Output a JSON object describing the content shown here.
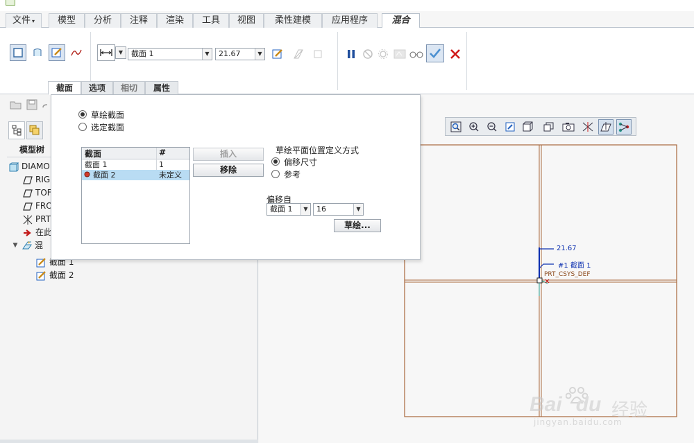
{
  "ribbon": {
    "tabs": [
      {
        "label": "文件",
        "has_menu": true
      },
      {
        "label": "模型"
      },
      {
        "label": "分析"
      },
      {
        "label": "注释"
      },
      {
        "label": "渲染"
      },
      {
        "label": "工具"
      },
      {
        "label": "视图"
      },
      {
        "label": "柔性建模"
      },
      {
        "label": "应用程序"
      },
      {
        "label": "混合",
        "active": true
      }
    ],
    "menu_caret": "▾",
    "section_combo": "截面 1",
    "depth_combo": "21.67",
    "dropdown_glyph": "▼"
  },
  "dashboard_tabs": [
    {
      "label": "截面",
      "active": true
    },
    {
      "label": "选项"
    },
    {
      "label": "相切",
      "dim": true
    },
    {
      "label": "属性"
    }
  ],
  "dialog": {
    "radio_sketch": "草绘截面",
    "radio_select": "选定截面",
    "table": {
      "col_section": "截面",
      "col_index": "#",
      "rows": [
        {
          "name": "截面 1",
          "index": "1"
        },
        {
          "name": "截面 2",
          "index": "未定义",
          "selected": true
        }
      ]
    },
    "insert_button": "插入",
    "remove_button": "移除",
    "plane_def_title": "草绘平面位置定义方式",
    "radio_offset": "偏移尺寸",
    "radio_reference": "参考",
    "offset_from_label": "偏移自",
    "offset_from_value": "截面 1",
    "offset_value": "16",
    "sketch_button": "草绘..."
  },
  "model_tree": {
    "header": "模型树",
    "items": [
      {
        "label": "DIAMO",
        "icon": "part-icon"
      },
      {
        "label": "RIG",
        "icon": "datum-plane-icon"
      },
      {
        "label": "TOF",
        "icon": "datum-plane-icon"
      },
      {
        "label": "FRO",
        "icon": "datum-plane-icon"
      },
      {
        "label": "PRT",
        "icon": "csys-icon"
      },
      {
        "label": "在此",
        "icon": "insert-here-arrow-icon"
      },
      {
        "label": "混",
        "icon": "blend-feature-icon"
      },
      {
        "label": "截面 1",
        "icon": "sketch-icon"
      },
      {
        "label": "截面 2",
        "icon": "sketch-icon"
      }
    ]
  },
  "graphics": {
    "dimension_label": "21.67",
    "section_label": "#1 截面 1",
    "csys_label": "PRT_CSYS_DEF"
  },
  "watermark": {
    "brand": "Bai",
    "brand_suffix": "du",
    "cn": "经验",
    "url": "jingyan.baidu.com"
  },
  "colors": {
    "accent_blue": "#1f5fbf",
    "sketch_brown": "#a8683c",
    "dim_blue": "#0b2fb0",
    "cancel_red": "#d01a1a",
    "ok_green_blue": "#4a8fd0"
  }
}
